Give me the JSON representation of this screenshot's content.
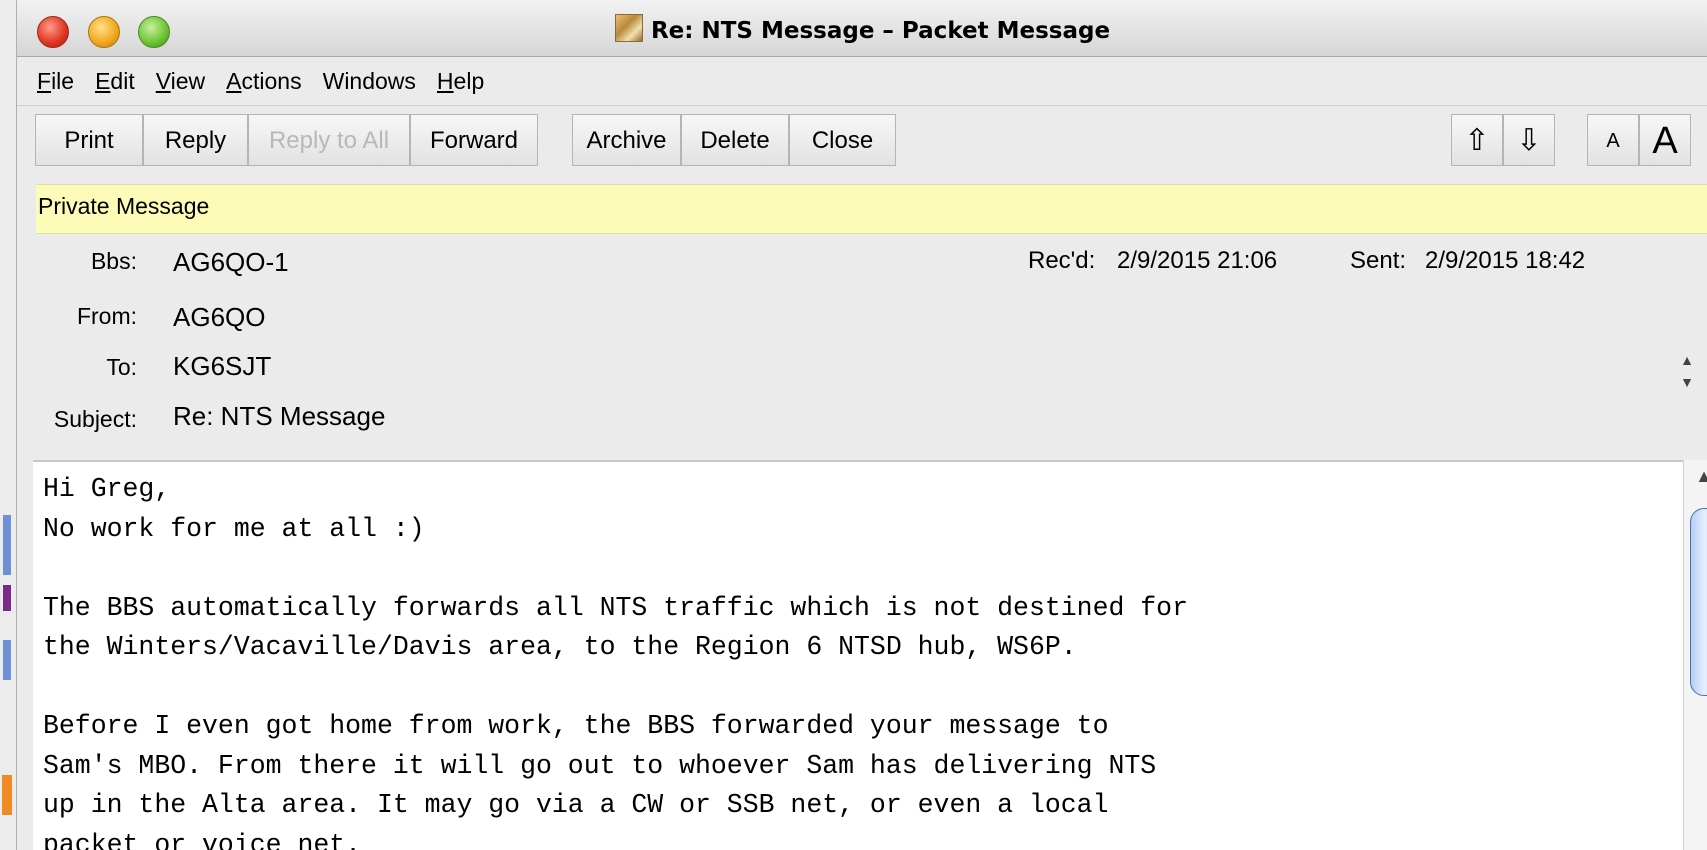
{
  "window": {
    "title": "Re: NTS Message – Packet Message",
    "title_icon": "packet-message-icon"
  },
  "menu": {
    "file": "File",
    "edit": "Edit",
    "view": "View",
    "actions": "Actions",
    "windows": "Windows",
    "help": "Help"
  },
  "toolbar": {
    "print": "Print",
    "reply": "Reply",
    "reply_all": "Reply to All",
    "forward": "Forward",
    "archive": "Archive",
    "delete": "Delete",
    "close": "Close",
    "prev_icon": "⇧",
    "next_icon": "⇩",
    "font_smaller": "A",
    "font_larger": "A"
  },
  "banner": "Private Message",
  "header": {
    "bbs_label": "Bbs:",
    "bbs_value": "AG6QO-1",
    "from_label": "From:",
    "from_value": "AG6QO",
    "to_label": "To:",
    "to_value": "KG6SJT",
    "subject_label": "Subject:",
    "subject_value": "Re: NTS Message",
    "received_label": "Rec'd:",
    "received_value": "2/9/2015 21:06",
    "sent_label": "Sent:",
    "sent_value": "2/9/2015 18:42"
  },
  "body": "Hi Greg,\nNo work for me at all :)\n\nThe BBS automatically forwards all NTS traffic which is not destined for\nthe Winters/Vacaville/Davis area, to the Region 6 NTSD hub, WS6P.\n\nBefore I even got home from work, the BBS forwarded your message to\nSam's MBO. From there it will go out to whoever Sam has delivering NTS\nup in the Alta area. It may go via a CW or SSB net, or even a local\npacket or voice net.",
  "colors": {
    "banner_bg": "#fcfcb8",
    "scroll_thumb": "#b6cdf2"
  }
}
